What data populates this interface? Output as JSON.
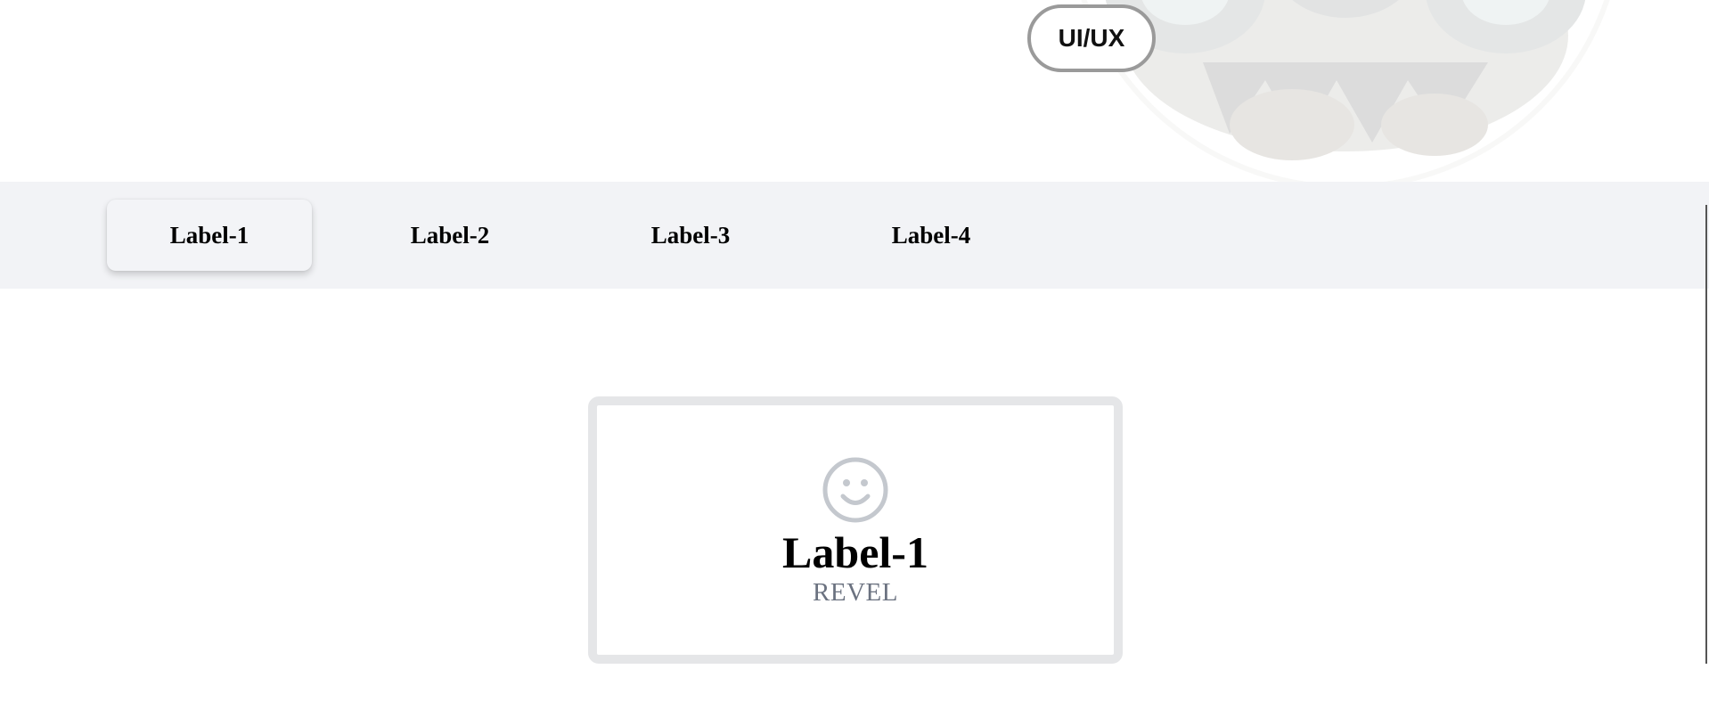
{
  "header": {
    "pill_label": "UI/UX",
    "hero_art_icon": "robot-illustration"
  },
  "tabs": [
    {
      "label": "Label-1",
      "active": true
    },
    {
      "label": "Label-2",
      "active": false
    },
    {
      "label": "Label-3",
      "active": false
    },
    {
      "label": "Label-4",
      "active": false
    }
  ],
  "panel": {
    "icon": "smiley-face-icon",
    "title": "Label-1",
    "subtitle": "REVEL"
  },
  "colors": {
    "tabbar_bg": "#f2f3f6",
    "card_border": "#e5e6e8",
    "icon_gray": "#c4c8ce",
    "subtitle_gray": "#6b7280",
    "pill_border": "#9a9a9a"
  }
}
